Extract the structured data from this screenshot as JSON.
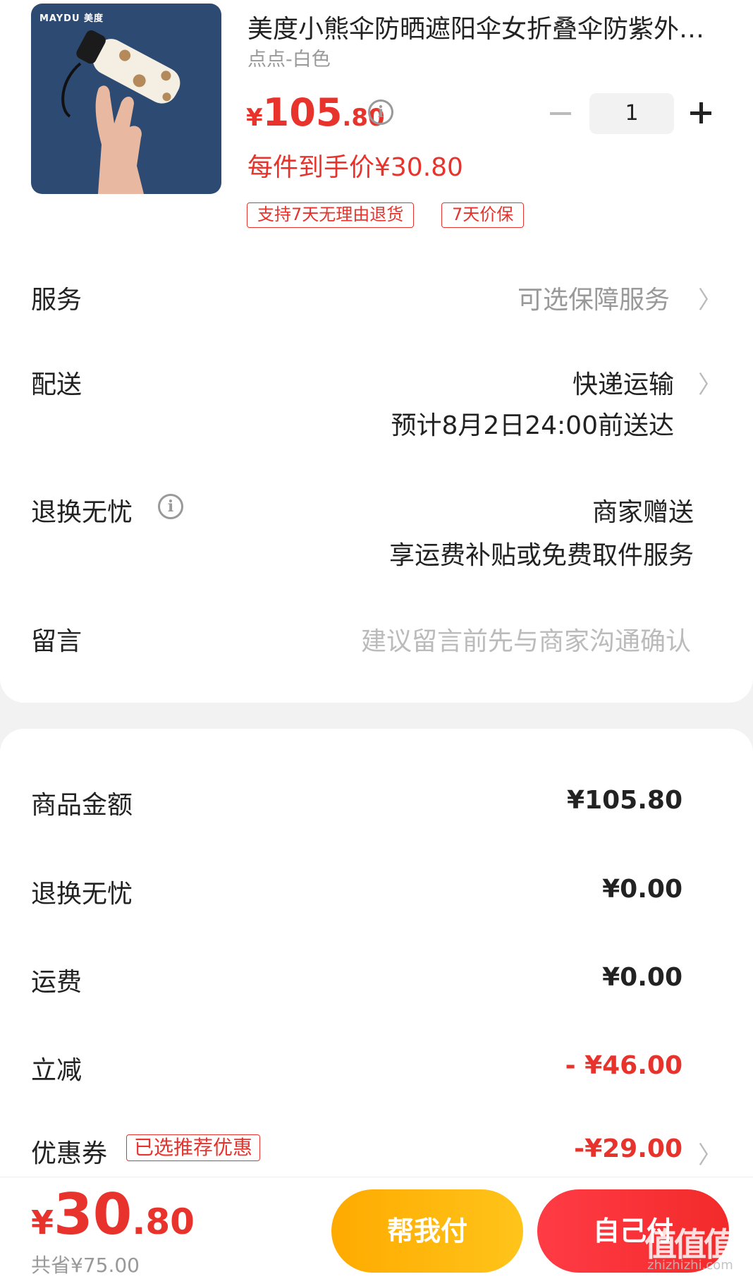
{
  "product": {
    "brand_logo": "MAYDU 美度",
    "title": "美度小熊伞防晒遮阳伞女折叠伞防紫外线太阳伞",
    "variant": "点点-白色",
    "price_symbol": "¥",
    "price_int": "105",
    "price_dec": ".80",
    "quantity": "1",
    "unit_price": "每件到手价¥30.80",
    "tags": [
      "支持7天无理由退货",
      "7天价保"
    ]
  },
  "rows": {
    "service": {
      "label": "服务",
      "value": "可选保障服务"
    },
    "delivery": {
      "label": "配送",
      "value": "快递运输",
      "eta": "预计8月2日24:00前送达"
    },
    "return": {
      "label": "退换无忧",
      "value": "商家赠送",
      "detail": "享运费补贴或免费取件服务"
    },
    "message": {
      "label": "留言",
      "placeholder": "建议留言前先与商家沟通确认"
    }
  },
  "summary": {
    "goods_label": "商品金额",
    "goods_value": "¥105.80",
    "return_label": "退换无忧",
    "return_value": "¥0.00",
    "shipping_label": "运费",
    "shipping_value": "¥0.00",
    "discount_label": "立减",
    "discount_value": "- ¥46.00",
    "coupon_label": "优惠券",
    "coupon_tag": "已选推荐优惠",
    "coupon_value": "-¥29.00"
  },
  "footer": {
    "total_symbol": "¥",
    "total_int": "30",
    "total_dec": ".80",
    "saved": "共省¥75.00",
    "help_pay": "帮我付",
    "self_pay": "自己付"
  },
  "watermark": {
    "main": "值值值",
    "sub": "zhizhizhi.com"
  },
  "colors": {
    "accent_red": "#e8332c",
    "help_btn": "#ffb400",
    "self_btn": "#f2303a"
  },
  "icons": [
    "info-icon",
    "chevron-right-icon",
    "minus-icon",
    "plus-icon"
  ]
}
